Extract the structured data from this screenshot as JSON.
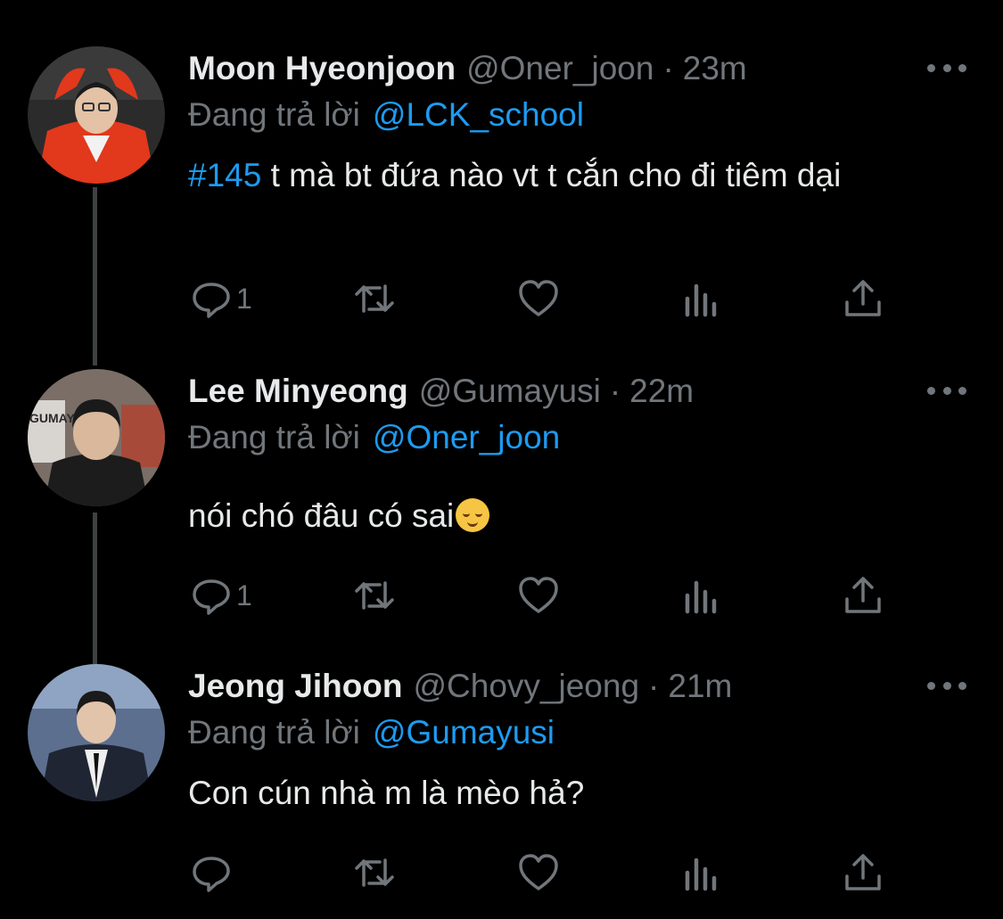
{
  "reply_prefix": "Đang trả lời",
  "tweets": [
    {
      "display_name": "Moon Hyeonjoon",
      "handle": "@Oner_joon",
      "separator": "·",
      "time": "23m",
      "reply_to": "@LCK_school",
      "hashtag": "#145",
      "text": " t mà bt đứa nào vt t cắn cho đi tiêm dại",
      "reply_count": "1",
      "avatar_colors": {
        "bg": "#2b2b2b",
        "jacket": "#e2381c",
        "skin": "#e3c2a6",
        "hair": "#1a1a1a"
      }
    },
    {
      "display_name": "Lee Minyeong",
      "handle": "@Gumayusi",
      "separator": "·",
      "time": "22m",
      "reply_to": "@Oner_joon",
      "text": "nói chó đâu có sai",
      "emoji": "relieved-face",
      "avatar_text": "GUMAY",
      "reply_count": "1",
      "avatar_colors": {
        "bg": "#7a6e66",
        "jacket": "#1c1c1c",
        "skin": "#d9b89c",
        "hair": "#1a1a1a"
      }
    },
    {
      "display_name": "Jeong Jihoon",
      "handle": "@Chovy_jeong",
      "separator": "·",
      "time": "21m",
      "reply_to": "@Gumayusi",
      "text": "Con cún nhà m là mèo hả?",
      "reply_count": "",
      "avatar_colors": {
        "bg": "#5c6f8f",
        "jacket": "#1f2533",
        "skin": "#e2c4ab",
        "hair": "#1a1a1a"
      }
    }
  ],
  "icons": {
    "reply": "reply-icon",
    "retweet": "retweet-icon",
    "like": "like-icon",
    "views": "views-icon",
    "share": "share-icon",
    "more": "more-icon"
  },
  "colors": {
    "background": "#000000",
    "primary_text": "#e7e9ea",
    "secondary_text": "#71767b",
    "accent": "#1d9bf0",
    "thread_line": "#3e4144"
  }
}
